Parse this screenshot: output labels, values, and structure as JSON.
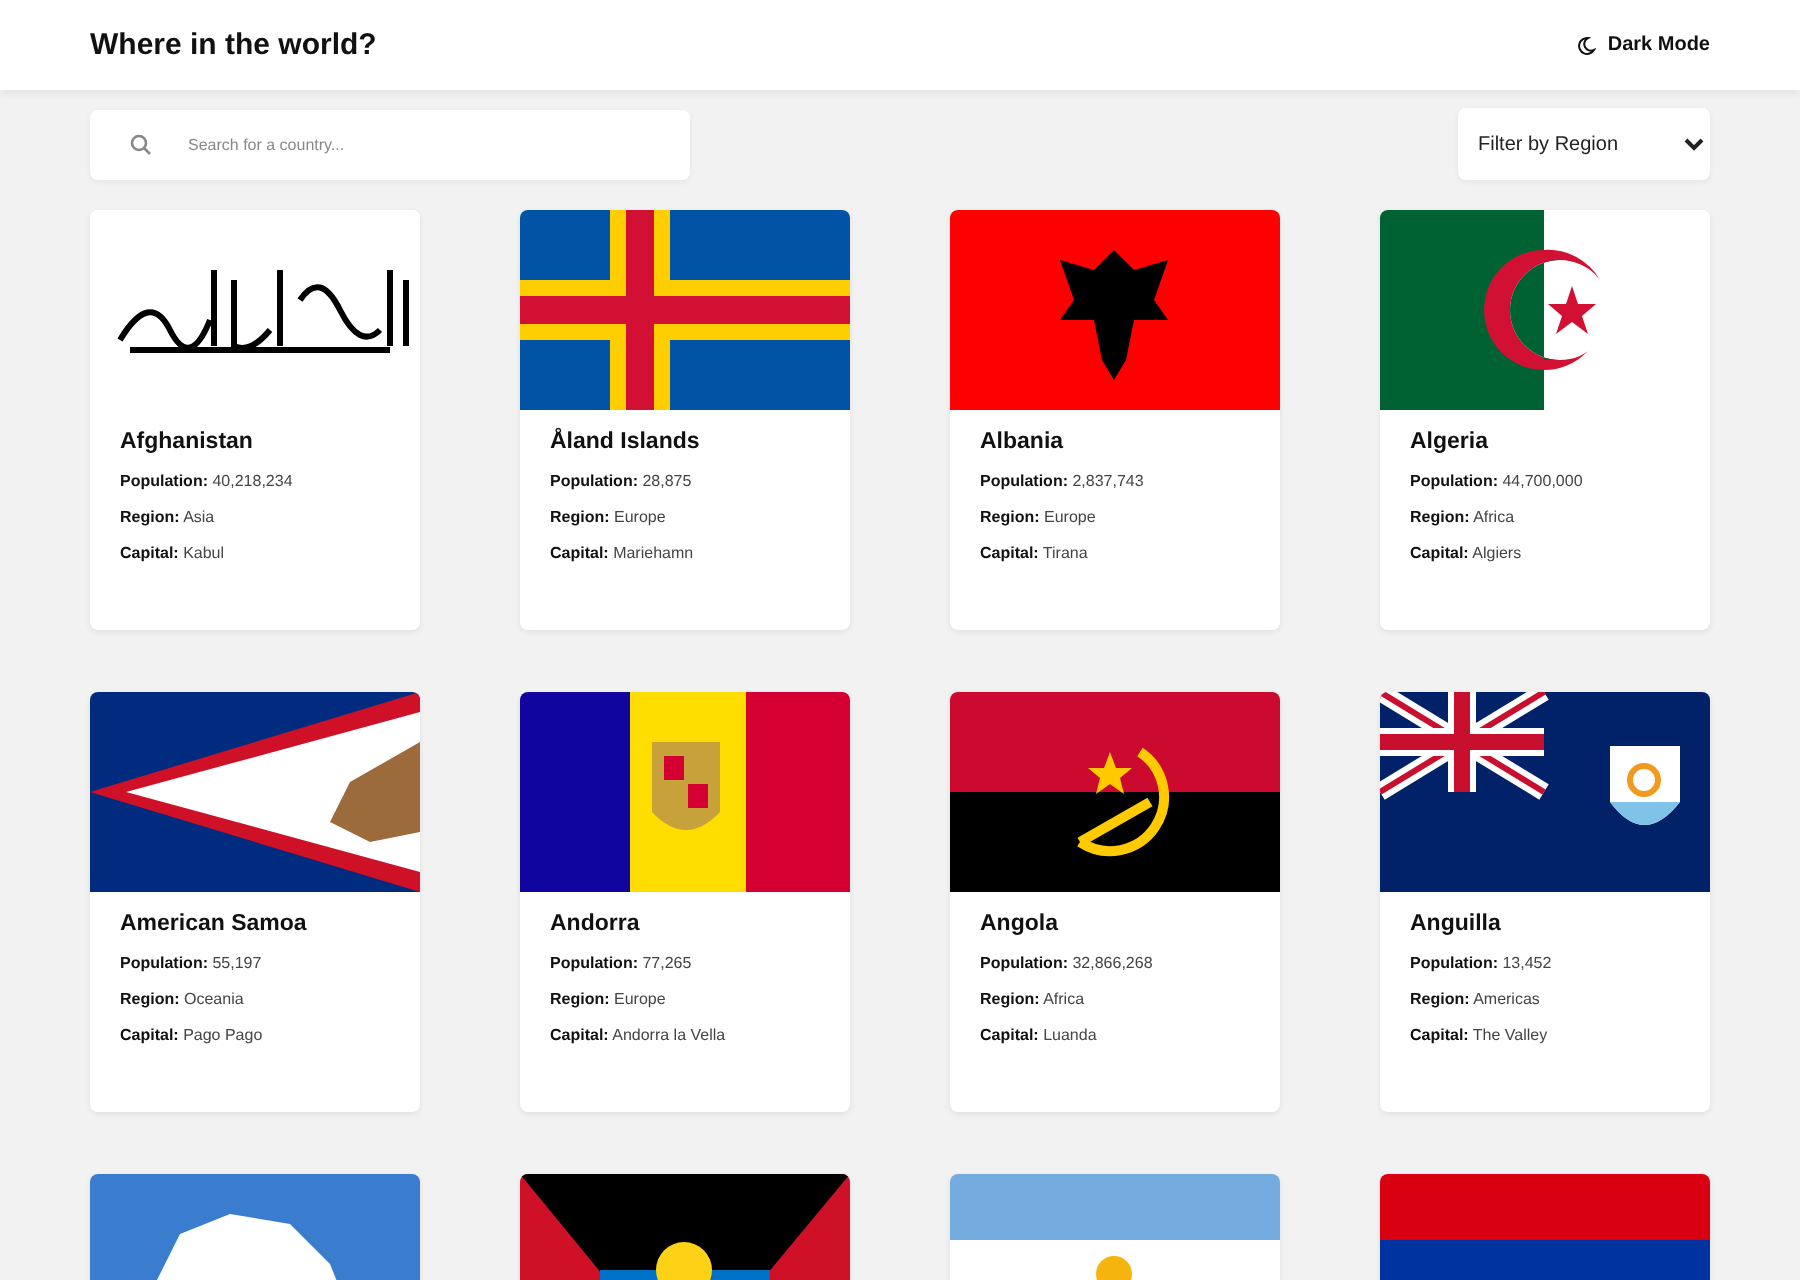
{
  "header": {
    "title": "Where in the world?",
    "theme_toggle": "Dark Mode"
  },
  "search": {
    "placeholder": "Search for a country..."
  },
  "filter": {
    "value": "Filter by Region"
  },
  "countries": [
    {
      "kind": "calligraphy",
      "name": "Afghanistan",
      "population_label": "Population:",
      "population": "40,218,234",
      "region_label": "Region:",
      "region": "Asia",
      "capital_label": "Capital:",
      "capital": "Kabul"
    },
    {
      "kind": "nordic-cross",
      "name": "Åland Islands",
      "population_label": "Population:",
      "population": "28,875",
      "region_label": "Region:",
      "region": "Europe",
      "capital_label": "Capital:",
      "capital": "Mariehamn"
    },
    {
      "kind": "eagle",
      "name": "Albania",
      "population_label": "Population:",
      "population": "2,837,743",
      "region_label": "Region:",
      "region": "Europe",
      "capital_label": "Capital:",
      "capital": "Tirana"
    },
    {
      "kind": "crescent",
      "name": "Algeria",
      "population_label": "Population:",
      "population": "44,700,000",
      "region_label": "Region:",
      "region": "Africa",
      "capital_label": "Capital:",
      "capital": "Algiers"
    },
    {
      "kind": "triangle",
      "name": "American Samoa",
      "population_label": "Population:",
      "population": "55,197",
      "region_label": "Region:",
      "region": "Oceania",
      "capital_label": "Capital:",
      "capital": "Pago Pago"
    },
    {
      "kind": "tricolor",
      "name": "Andorra",
      "population_label": "Population:",
      "population": "77,265",
      "region_label": "Region:",
      "region": "Europe",
      "capital_label": "Capital:",
      "capital": "Andorra la Vella"
    },
    {
      "kind": "emblem",
      "name": "Angola",
      "population_label": "Population:",
      "population": "32,866,268",
      "region_label": "Region:",
      "region": "Africa",
      "capital_label": "Capital:",
      "capital": "Luanda"
    },
    {
      "kind": "ensign",
      "name": "Anguilla",
      "population_label": "Population:",
      "population": "13,452",
      "region_label": "Region:",
      "region": "Americas",
      "capital_label": "Capital:",
      "capital": "The Valley"
    },
    {
      "kind": "map"
    },
    {
      "kind": "sunrise"
    },
    {
      "kind": "stripes"
    },
    {
      "kind": "bands"
    }
  ]
}
